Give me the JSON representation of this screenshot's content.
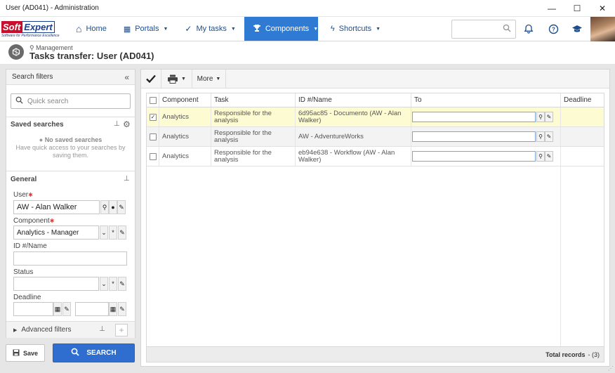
{
  "window": {
    "title": "User (AD041) - Administration",
    "minimize": "—",
    "maximize": "☐",
    "close": "✕"
  },
  "brand": {
    "soft": "Soft",
    "expert": "Expert",
    "tagline": "Software for Performance Excellence"
  },
  "nav": {
    "items": [
      {
        "label": "Home",
        "icon": "home-icon",
        "glyph": "⌂"
      },
      {
        "label": "Portals",
        "icon": "grid-icon",
        "glyph": "▦"
      },
      {
        "label": "My tasks",
        "icon": "check-icon",
        "glyph": "✓"
      },
      {
        "label": "Components",
        "icon": "trophy-icon",
        "glyph": "🏆"
      },
      {
        "label": "Shortcuts",
        "icon": "bolt-icon",
        "glyph": "⚡"
      }
    ],
    "active": "Components",
    "search_placeholder": ""
  },
  "page": {
    "breadcrumb": "Management",
    "title": "Tasks transfer: User (AD041)"
  },
  "filters": {
    "header": "Search filters",
    "quick_search_placeholder": "Quick search",
    "saved_searches_title": "Saved searches",
    "no_saved_title": "No saved searches",
    "no_saved_desc_1": "Have quick access to your searches by",
    "no_saved_desc_2": "saving them.",
    "general_title": "General",
    "user_label": "User",
    "user_value": "AW - Alan Walker",
    "component_label": "Component",
    "component_value": "Analytics - Manager",
    "id_label": "ID #/Name",
    "id_value": "",
    "status_label": "Status",
    "status_value": "",
    "deadline_label": "Deadline",
    "advanced_label": "Advanced filters",
    "save_button": "Save",
    "search_button": "SEARCH"
  },
  "toolbar": {
    "more_label": "More"
  },
  "grid": {
    "columns": [
      "Component",
      "Task",
      "ID #/Name",
      "To",
      "Deadline"
    ],
    "rows": [
      {
        "checked": true,
        "component": "Analytics",
        "task": "Responsible for the analysis",
        "id_line1": "6d95ac85 - Documento (AW - Alan",
        "id_line2": "Walker)",
        "to": "",
        "deadline": ""
      },
      {
        "checked": false,
        "component": "Analytics",
        "task": "Responsible for the analysis",
        "id_line1": "AW - AdventureWorks",
        "id_line2": "",
        "to": "",
        "deadline": ""
      },
      {
        "checked": false,
        "component": "Analytics",
        "task": "Responsible for the analysis",
        "id_line1": "eb94e638 - Workflow (AW - Alan Walker)",
        "id_line2": "",
        "to": "",
        "deadline": ""
      }
    ],
    "total_label": "Total records",
    "total_value": "- (3)"
  },
  "colors": {
    "nav_active": "#2f7ad3",
    "search_button": "#2f6ecf",
    "selected_row": "#fdfbd1",
    "brand_red": "#c8102e",
    "brand_blue": "#1a3d8f"
  }
}
